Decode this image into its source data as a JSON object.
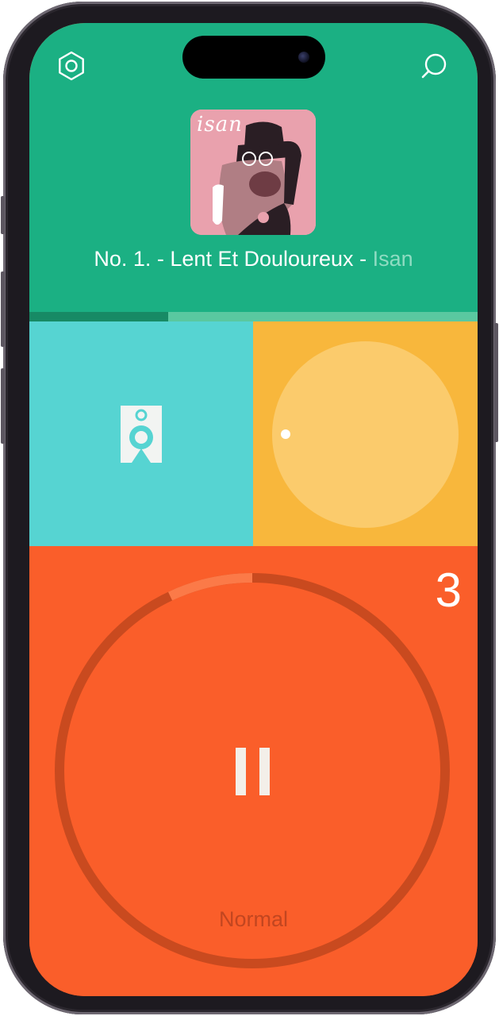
{
  "header": {
    "track_title": "No. 1. - Lent Et Douloureux",
    "separator": " - ",
    "artist": "Isan",
    "album_art_text": "isan",
    "settings_icon": "hexagon-gear-icon",
    "search_icon": "search-icon"
  },
  "progress": {
    "fraction": 0.31,
    "fill_color": "#178a65",
    "track_color": "#5ac8a0"
  },
  "speaker_tile": {
    "icon": "speaker-icon",
    "color": "#56d4d2"
  },
  "dial_tile": {
    "color": "#f8b73c",
    "dial_color": "#fbcb6c"
  },
  "player": {
    "count": "3",
    "mode_label": "Normal",
    "ring_progress": 0.07,
    "color": "#fa5e2a",
    "ring_color": "#c94a1f",
    "ring_progress_color": "#fb7a48"
  },
  "colors": {
    "header_bg": "#1bb083",
    "artist_text": "#8fdcc2"
  }
}
